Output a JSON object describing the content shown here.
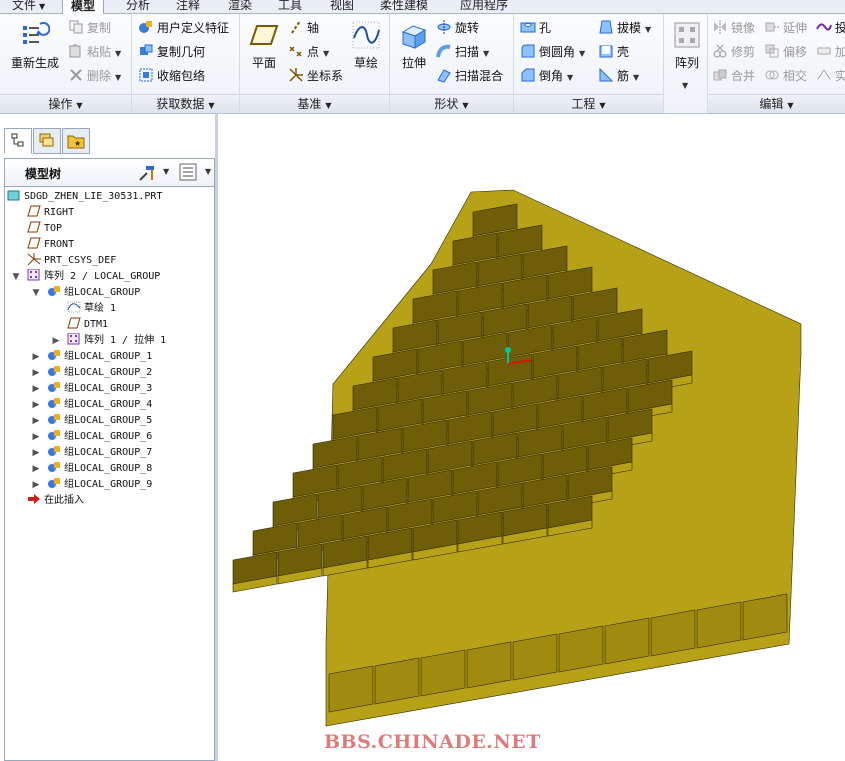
{
  "ribbon": {
    "tabs": [
      {
        "label": "文件",
        "has_dropdown": true
      },
      {
        "label": "模型",
        "active": true
      },
      {
        "label": "分析"
      },
      {
        "label": "注释"
      },
      {
        "label": "渲染"
      },
      {
        "label": "工具"
      },
      {
        "label": "视图"
      },
      {
        "label": "柔性建模"
      },
      {
        "label": "应用程序"
      }
    ],
    "groups": {
      "operations": {
        "label": "操作",
        "regenerate": "重新生成",
        "copy": "复制",
        "paste": "粘贴",
        "delete": "删除"
      },
      "get_data": {
        "label": "获取数据",
        "udf": "用户定义特征",
        "copy_geometry": "复制几何",
        "shrinkwrap": "收缩包络"
      },
      "datum": {
        "label": "基准",
        "plane": "平面",
        "axis": "轴",
        "point": "点",
        "csys": "坐标系",
        "sketch": "草绘"
      },
      "shapes": {
        "label": "形状",
        "extrude": "拉伸",
        "revolve": "旋转",
        "sweep": "扫描",
        "swept_blend": "扫描混合"
      },
      "engineering": {
        "label": "工程",
        "hole": "孔",
        "round": "倒圆角",
        "chamfer": "倒角",
        "draft": "拔模",
        "shell": "壳",
        "rib": "筋"
      },
      "pattern": {
        "label": "阵列"
      },
      "editing": {
        "label": "编辑",
        "mirror": "镜像",
        "trim": "修剪",
        "merge": "合并",
        "extend": "延伸",
        "offset": "偏移",
        "intersect": "相交",
        "project": "投",
        "thicken": "加",
        "solidify": "实"
      }
    }
  },
  "model_tree": {
    "title": "模型树",
    "items": [
      {
        "label": "SDGD_ZHEN_LIE_30531.PRT",
        "icon": "part-icon"
      },
      {
        "label": "RIGHT",
        "icon": "datum-plane-icon"
      },
      {
        "label": "TOP",
        "icon": "datum-plane-icon"
      },
      {
        "label": "FRONT",
        "icon": "datum-plane-icon"
      },
      {
        "label": "PRT_CSYS_DEF",
        "icon": "csys-icon"
      },
      {
        "label": "阵列 2 / LOCAL_GROUP",
        "icon": "pattern-icon",
        "expanded": true
      },
      {
        "label": "组LOCAL_GROUP",
        "icon": "group-icon",
        "expanded": true
      },
      {
        "label": "草绘 1",
        "icon": "sketch-icon"
      },
      {
        "label": "DTM1",
        "icon": "datum-plane-icon"
      },
      {
        "label": "阵列 1 / 拉伸 1",
        "icon": "pattern-icon",
        "expanded": false
      },
      {
        "label": "组LOCAL_GROUP_1",
        "icon": "group-icon",
        "expanded": false
      },
      {
        "label": "组LOCAL_GROUP_2",
        "icon": "group-icon",
        "expanded": false
      },
      {
        "label": "组LOCAL_GROUP_3",
        "icon": "group-icon",
        "expanded": false
      },
      {
        "label": "组LOCAL_GROUP_4",
        "icon": "group-icon",
        "expanded": false
      },
      {
        "label": "组LOCAL_GROUP_5",
        "icon": "group-icon",
        "expanded": false
      },
      {
        "label": "组LOCAL_GROUP_6",
        "icon": "group-icon",
        "expanded": false
      },
      {
        "label": "组LOCAL_GROUP_7",
        "icon": "group-icon",
        "expanded": false
      },
      {
        "label": "组LOCAL_GROUP_8",
        "icon": "group-icon",
        "expanded": false
      },
      {
        "label": "组LOCAL_GROUP_9",
        "icon": "group-icon",
        "expanded": false
      },
      {
        "label": "在此插入",
        "icon": "insert-here-icon"
      }
    ]
  },
  "viewport": {
    "watermark": "BBS.CHINADE.NET",
    "model_colors": {
      "top": "#a08a10",
      "front": "#6f5e08",
      "side": "#b7a217",
      "edge": "#2f2700"
    }
  },
  "colors": {
    "accent": "#2a6bd1",
    "watermark": "#e07b7b"
  }
}
